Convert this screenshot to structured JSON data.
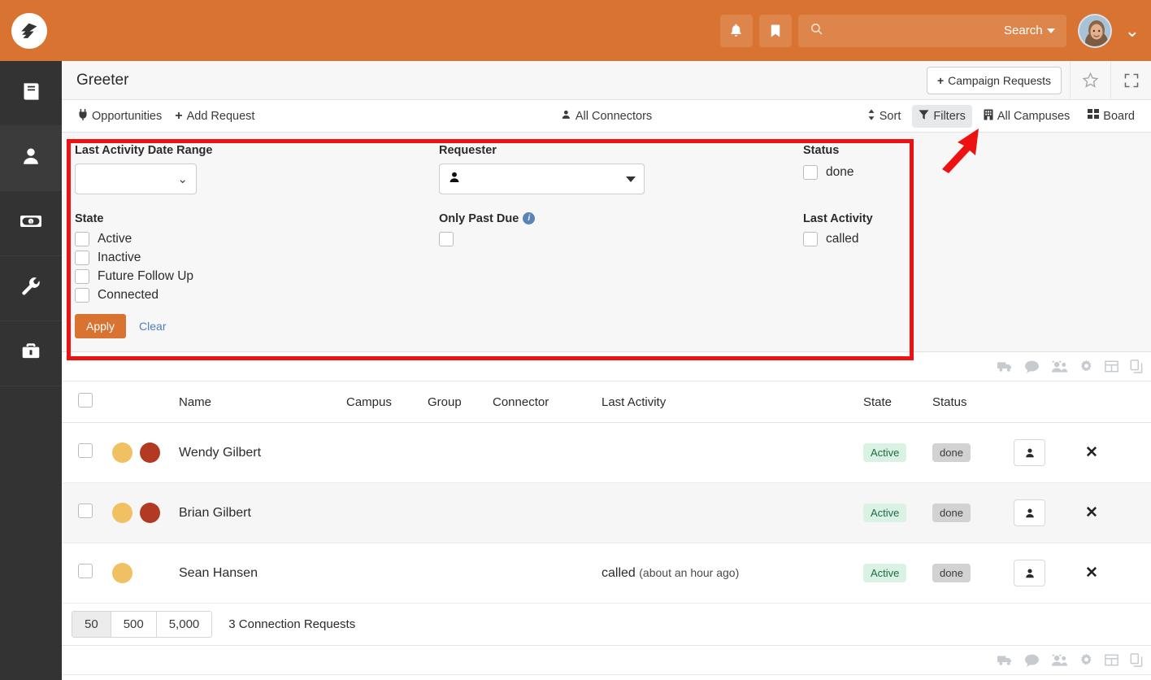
{
  "topbar": {
    "brand_icon": "mountain-logo-icon",
    "notifications_icon": "bell-icon",
    "bookmark_icon": "bookmark-icon",
    "search_icon": "search-icon",
    "search_value": "",
    "search_placeholder": "",
    "search_scope_label": "Search",
    "user_menu_icon": "chevron-down-icon",
    "brand_color": "#d97332"
  },
  "sidebar": {
    "items": [
      {
        "icon": "book-icon",
        "name": "sidebar-item-book"
      },
      {
        "icon": "user-icon",
        "name": "sidebar-item-people"
      },
      {
        "icon": "money-bill-icon",
        "name": "sidebar-item-giving"
      },
      {
        "icon": "wrench-icon",
        "name": "sidebar-item-tools"
      },
      {
        "icon": "briefcase-icon",
        "name": "sidebar-item-admin"
      }
    ]
  },
  "page": {
    "title": "Greeter",
    "campaign_requests_label": "Campaign Requests",
    "star_icon": "star-icon",
    "expand_icon": "expand-icon"
  },
  "toolbar": {
    "left": [
      {
        "label": "Opportunities",
        "icon": "plug-icon"
      },
      {
        "label": "Add Request",
        "icon": "plus-icon"
      }
    ],
    "center": {
      "label": "All Connectors",
      "icon": "user-icon"
    },
    "right": [
      {
        "label": "Sort",
        "icon": "sort-icon",
        "active": false
      },
      {
        "label": "Filters",
        "icon": "filter-icon",
        "active": true
      },
      {
        "label": "All Campuses",
        "icon": "building-icon",
        "active": false
      },
      {
        "label": "Board",
        "icon": "grid-icon",
        "active": false
      }
    ]
  },
  "filters": {
    "date_range_label": "Last Activity Date Range",
    "date_range_value": "",
    "requester_label": "Requester",
    "requester_value": "",
    "requester_icon": "user-icon",
    "status_label": "Status",
    "status_options": [
      {
        "label": "done",
        "checked": false
      }
    ],
    "state_label": "State",
    "state_options": [
      {
        "label": "Active",
        "checked": false
      },
      {
        "label": "Inactive",
        "checked": false
      },
      {
        "label": "Future Follow Up",
        "checked": false
      },
      {
        "label": "Connected",
        "checked": false
      }
    ],
    "only_past_due_label": "Only Past Due",
    "only_past_due_info_icon": "info-icon",
    "only_past_due_checked": false,
    "last_activity_label": "Last Activity",
    "last_activity_options": [
      {
        "label": "called",
        "checked": false
      }
    ],
    "apply_label": "Apply",
    "clear_label": "Clear",
    "highlight_color": "#ee1111"
  },
  "table_icons": [
    {
      "icon": "truck-icon",
      "name": "bulk-mail-icon"
    },
    {
      "icon": "comment-icon",
      "name": "bulk-sms-icon"
    },
    {
      "icon": "users-icon",
      "name": "bulk-group-icon"
    },
    {
      "icon": "gear-icon",
      "name": "settings-icon"
    },
    {
      "icon": "table-icon",
      "name": "columns-icon"
    },
    {
      "icon": "copy-icon",
      "name": "copy-icon"
    }
  ],
  "table": {
    "columns": [
      "",
      "",
      "Name",
      "Campus",
      "Group",
      "Connector",
      "Last Activity",
      "State",
      "Status",
      "",
      ""
    ],
    "rows": [
      {
        "selected": false,
        "dots": [
          "#f0c062",
          "#b33a22"
        ],
        "name": "Wendy Gilbert",
        "campus": "",
        "group": "",
        "connector": "",
        "last_activity": "",
        "last_activity_when": "",
        "state": "Active",
        "status": "done",
        "assign_icon": "user-icon",
        "remove_icon": "close-icon"
      },
      {
        "selected": false,
        "dots": [
          "#f0c062",
          "#b33a22"
        ],
        "name": "Brian Gilbert",
        "campus": "",
        "group": "",
        "connector": "",
        "last_activity": "",
        "last_activity_when": "",
        "state": "Active",
        "status": "done",
        "assign_icon": "user-icon",
        "remove_icon": "close-icon"
      },
      {
        "selected": false,
        "dots": [
          "#f0c062"
        ],
        "name": "Sean Hansen",
        "campus": "",
        "group": "",
        "connector": "",
        "last_activity": "called",
        "last_activity_when": "(about an hour ago)",
        "state": "Active",
        "status": "done",
        "assign_icon": "user-icon",
        "remove_icon": "close-icon"
      }
    ]
  },
  "footer": {
    "page_sizes": [
      {
        "label": "50",
        "selected": true
      },
      {
        "label": "500",
        "selected": false
      },
      {
        "label": "5,000",
        "selected": false
      }
    ],
    "count_text": "3 Connection Requests"
  }
}
